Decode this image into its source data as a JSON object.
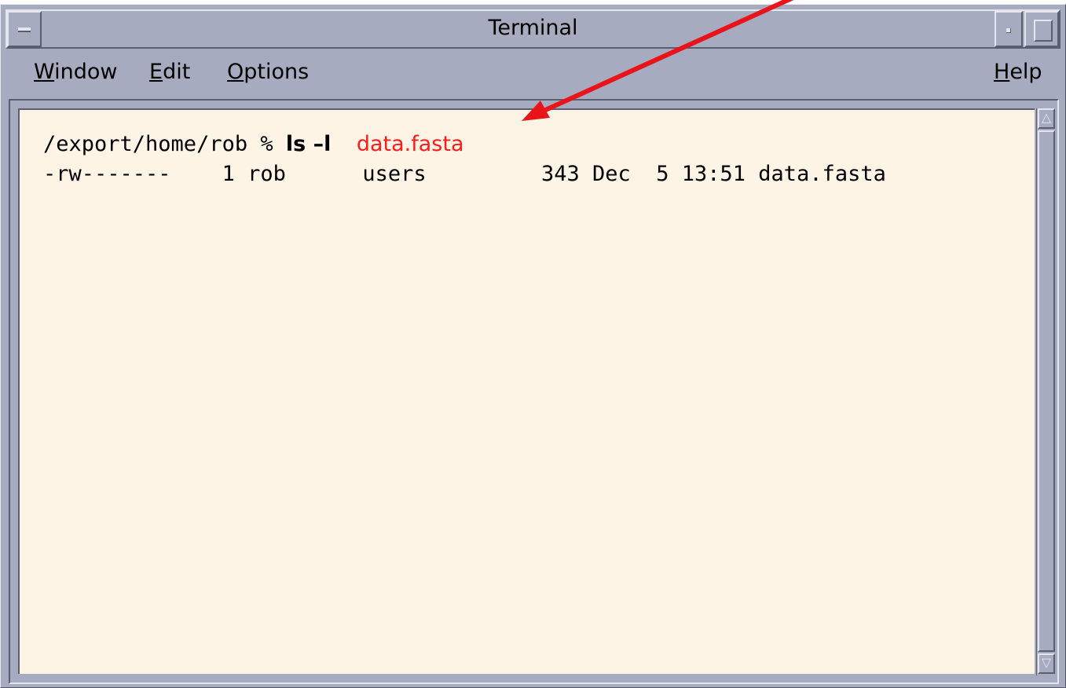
{
  "window": {
    "title": "Terminal"
  },
  "menubar": {
    "window": {
      "mnemonic": "W",
      "rest": "indow"
    },
    "edit": {
      "mnemonic": "E",
      "rest": "dit"
    },
    "options": {
      "mnemonic": "O",
      "rest": "ptions"
    },
    "help": {
      "pre": "",
      "mnemonic": "H",
      "rest": "elp"
    }
  },
  "terminal": {
    "prompt": "/export/home/rob % ",
    "command": "ls –l",
    "argument": "data.fasta",
    "output": "-rw-------    1 rob      users         343 Dec  5 13:51 data.fasta"
  },
  "colors": {
    "annotation": "#e8141a",
    "terminal_background": "#fdf4e6",
    "chrome": "#a7abc0"
  },
  "icons": {
    "window_menu": "window-menu-icon",
    "minimize": "minimize-icon",
    "maximize": "maximize-icon",
    "scroll_up": "scroll-up-arrow-icon",
    "scroll_down": "scroll-down-arrow-icon"
  }
}
